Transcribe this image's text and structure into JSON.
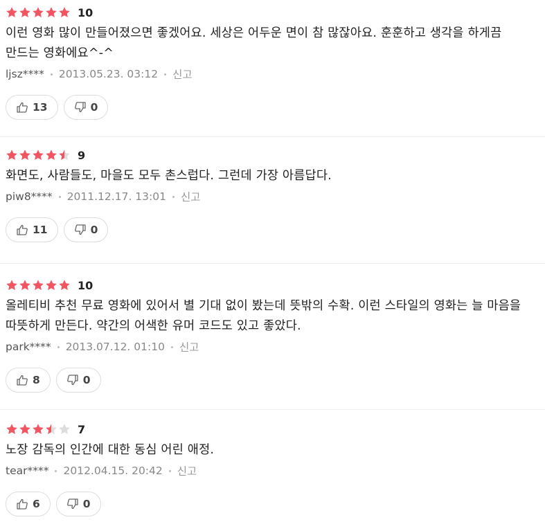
{
  "colors": {
    "star_filled": "#f25562",
    "star_empty": "#dddddd"
  },
  "reviews": [
    {
      "rating": 5,
      "score": "10",
      "text": "이런 영화 많이 만들어졌으면 좋겠어요. 세상은 어두운 면이 참 많잖아요. 훈훈하고 생각을 하게끔 만드는 영화에요^-^",
      "user": "ljsz****",
      "date": "2013.05.23. 03:12",
      "report": "신고",
      "likes": "13",
      "dislikes": "0"
    },
    {
      "rating": 4.5,
      "score": "9",
      "text": "화면도, 사람들도, 마을도 모두 촌스럽다. 그런데 가장 아름답다.",
      "user": "piw8****",
      "date": "2011.12.17. 13:01",
      "report": "신고",
      "likes": "11",
      "dislikes": "0"
    },
    {
      "rating": 5,
      "score": "10",
      "text": "올레티비 추천 무료 영화에 있어서 별 기대 없이 봤는데 뜻밖의 수확. 이런 스타일의 영화는 늘 마음을 따뜻하게 만든다. 약간의 어색한 유머 코드도 있고 좋았다.",
      "user": "park****",
      "date": "2013.07.12. 01:10",
      "report": "신고",
      "likes": "8",
      "dislikes": "0"
    },
    {
      "rating": 3.5,
      "score": "7",
      "text": "노장 감독의 인간에 대한 동심 어린 애정.",
      "user": "tear****",
      "date": "2012.04.15. 20:42",
      "report": "신고",
      "likes": "6",
      "dislikes": "0"
    }
  ]
}
